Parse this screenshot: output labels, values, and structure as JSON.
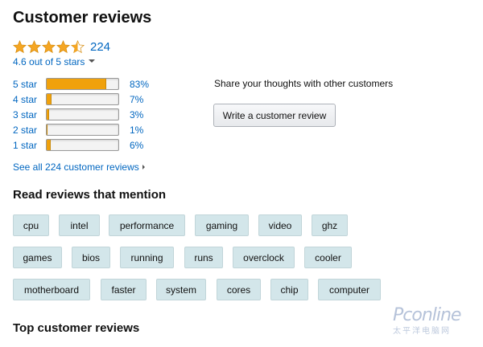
{
  "header": {
    "title": "Customer reviews"
  },
  "rating": {
    "count": "224",
    "out_of": "4.6 out of 5 stars",
    "value": 4.6,
    "star_color": "#f5a623"
  },
  "histogram": [
    {
      "label": "5 star",
      "pct": "83%",
      "fraction": 0.83
    },
    {
      "label": "4 star",
      "pct": "7%",
      "fraction": 0.07
    },
    {
      "label": "3 star",
      "pct": "3%",
      "fraction": 0.03
    },
    {
      "label": "2 star",
      "pct": "1%",
      "fraction": 0.01
    },
    {
      "label": "1 star",
      "pct": "6%",
      "fraction": 0.06
    }
  ],
  "see_all": "See all 224 customer reviews",
  "share": {
    "text": "Share your thoughts with other customers",
    "button": "Write a customer review"
  },
  "mentions": {
    "title": "Read reviews that mention",
    "tags": [
      "cpu",
      "intel",
      "performance",
      "gaming",
      "video",
      "ghz",
      "games",
      "bios",
      "running",
      "runs",
      "overclock",
      "cooler",
      "motherboard",
      "faster",
      "system",
      "cores",
      "chip",
      "computer"
    ]
  },
  "top_reviews": {
    "title": "Top customer reviews"
  },
  "watermark": {
    "text": "Pconline",
    "sub": "太平洋电脑网"
  },
  "colors": {
    "link": "#0066c0",
    "bar_fill": "#f0a10c",
    "tag_bg": "#d3e6ea"
  }
}
